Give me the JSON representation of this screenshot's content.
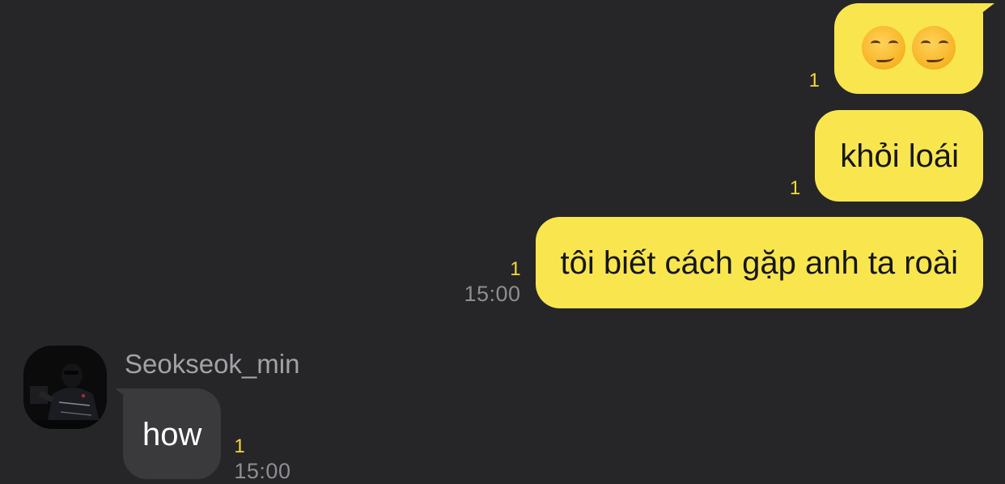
{
  "messages_sent": [
    {
      "content": "😏😏",
      "emoji_count": 2,
      "emoji_icon": "smirking-face-icon",
      "unread": "1",
      "time": ""
    },
    {
      "content": "khỏi loái",
      "unread": "1",
      "time": ""
    },
    {
      "content": "tôi biết cách gặp anh ta roài",
      "unread": "1",
      "time": "15:00"
    }
  ],
  "received": {
    "sender": "Seokseok_min",
    "content": "how",
    "unread": "1",
    "time": "15:00"
  },
  "colors": {
    "background": "#262628",
    "sent_bubble": "#f9e64f",
    "received_bubble": "#3a3a3c",
    "unread_count": "#f5d83a",
    "timestamp": "#8d8d92"
  }
}
